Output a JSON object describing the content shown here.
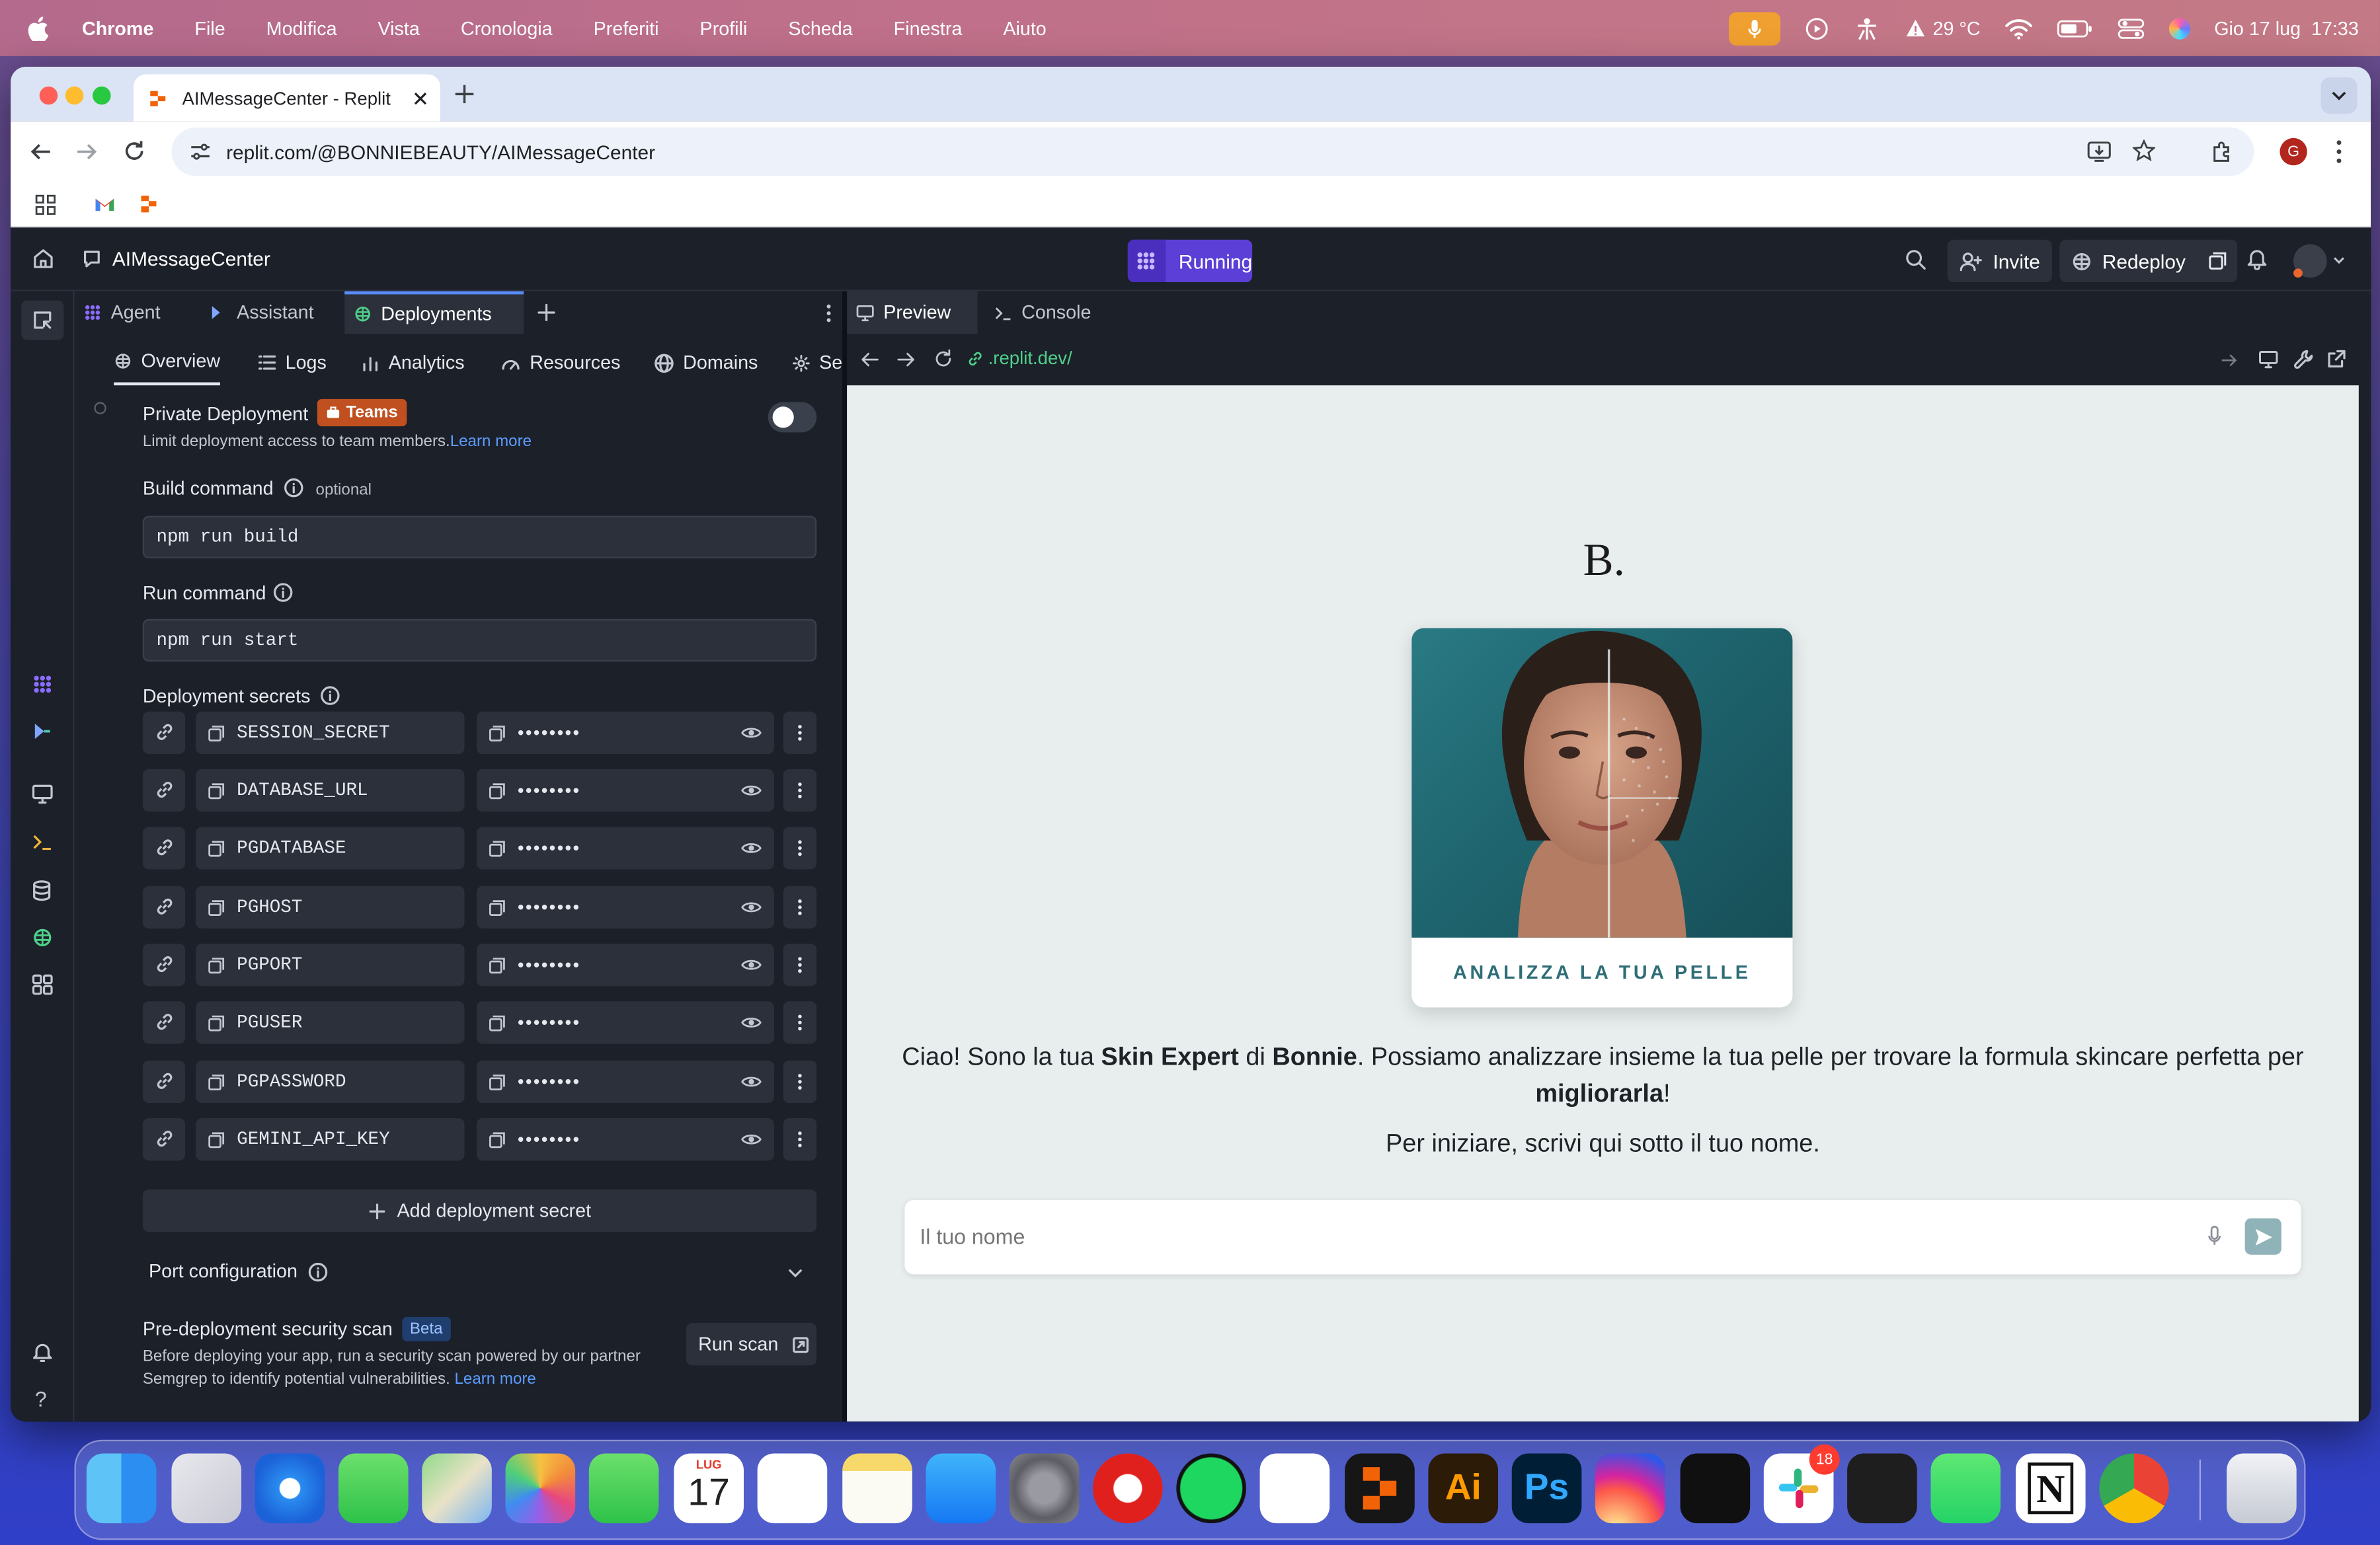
{
  "menubar": {
    "apple": "",
    "items": [
      "Chrome",
      "File",
      "Modifica",
      "Vista",
      "Cronologia",
      "Preferiti",
      "Profili",
      "Scheda",
      "Finestra",
      "Aiuto"
    ],
    "temperature": "29 °C",
    "datetime": "Gio 17 lug  17:33"
  },
  "browser": {
    "tab_title": "AIMessageCenter - Replit",
    "url": "replit.com/@BONNIEBEAUTY/AIMessageCenter",
    "profile_initial": "G"
  },
  "replit": {
    "project_name": "AIMessageCenter",
    "run_status": "Running",
    "invite_label": "Invite",
    "redeploy_label": "Redeploy",
    "pane_tabs": [
      "Agent",
      "Assistant",
      "Deployments"
    ],
    "sub_tabs": [
      "Overview",
      "Logs",
      "Analytics",
      "Resources",
      "Domains",
      "Se"
    ],
    "private_deployment": {
      "title": "Private Deployment",
      "badge": "Teams",
      "desc": "Limit deployment access to team members.",
      "learn_more": "Learn more"
    },
    "build_command": {
      "label": "Build command",
      "optional": "optional",
      "value": "npm run build"
    },
    "run_command": {
      "label": "Run command",
      "value": "npm run start"
    },
    "secrets_label": "Deployment secrets",
    "secrets": [
      {
        "key": "SESSION_SECRET",
        "value": "••••••••"
      },
      {
        "key": "DATABASE_URL",
        "value": "••••••••"
      },
      {
        "key": "PGDATABASE",
        "value": "••••••••"
      },
      {
        "key": "PGHOST",
        "value": "••••••••"
      },
      {
        "key": "PGPORT",
        "value": "••••••••"
      },
      {
        "key": "PGUSER",
        "value": "••••••••"
      },
      {
        "key": "PGPASSWORD",
        "value": "••••••••"
      },
      {
        "key": "GEMINI_API_KEY",
        "value": "••••••••"
      }
    ],
    "add_secret_label": "Add deployment secret",
    "port_configuration": "Port configuration",
    "security_scan": {
      "title": "Pre-deployment security scan",
      "badge": "Beta",
      "desc_line1": "Before deploying your app, run a security scan powered by our partner",
      "desc_line2": "Semgrep to identify potential vulnerabilities.",
      "learn_more": "Learn more",
      "run_label": "Run scan"
    },
    "preview_tabs": [
      "Preview",
      "Console"
    ],
    "preview_url_prefix": "",
    "preview_url": ".replit.dev/"
  },
  "website": {
    "logo": "B.",
    "card_cta": "ANALIZZA LA TUA PELLE",
    "intro_1": "Ciao! Sono la tua ",
    "intro_bold_1": "Skin Expert",
    "intro_2": " di ",
    "intro_bold_2": "Bonnie",
    "intro_3": ". Possiamo analizzare insieme la tua pelle per trovare la formula skincare perfetta per ",
    "intro_bold_3": "migliorarla",
    "intro_4": "!",
    "instruction": "Per iniziare, scrivi qui sotto il tuo nome.",
    "name_placeholder": "Il tuo nome"
  },
  "dock": {
    "calendar_month": "LUG",
    "calendar_day": "17",
    "slack_badge": "18",
    "apps": [
      "finder-icon",
      "launchpad-icon",
      "safari-icon",
      "messages-icon",
      "maps-icon",
      "photos-icon",
      "facetime-icon",
      "calendar-icon",
      "reminders-icon",
      "notes-icon",
      "app-store-icon",
      "system-settings-icon",
      "opera-icon",
      "spotify-icon",
      "chatgpt-icon",
      "replit-icon",
      "illustrator-icon",
      "photoshop-icon",
      "instagram-icon",
      "threads-icon",
      "slack-icon",
      "figma-icon",
      "whatsapp-icon",
      "notion-icon",
      "chrome-icon",
      "trash-icon"
    ]
  },
  "colors": {
    "accent_purple": "#5b3fd6",
    "teams_badge": "#c0501f",
    "link_blue": "#5b9cff",
    "teal_brand": "#2e6d77"
  }
}
